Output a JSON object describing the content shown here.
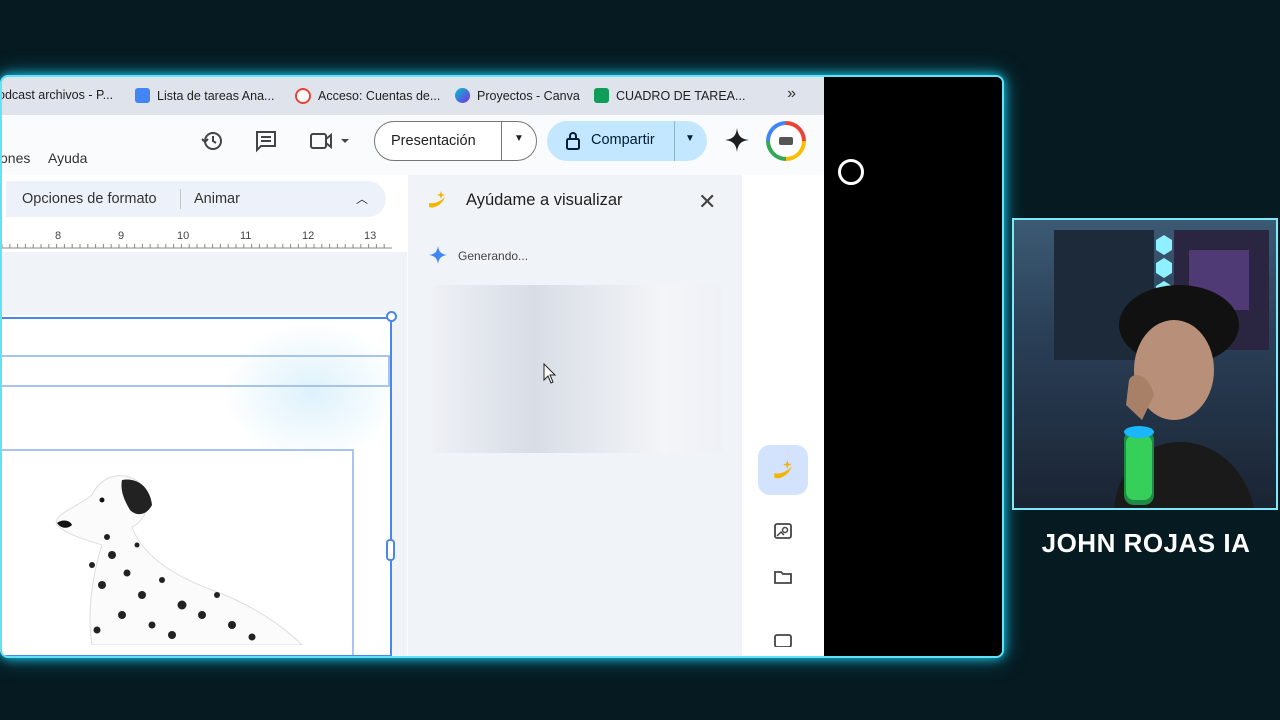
{
  "bookmarks": [
    {
      "label": "odcast archivos - P...",
      "icon": "page-icon",
      "color": "#777777"
    },
    {
      "label": "Lista de tareas Ana...",
      "icon": "docs-icon",
      "color": "#4285f4"
    },
    {
      "label": "Acceso: Cuentas de...",
      "icon": "google-icon",
      "color": "#ea4335"
    },
    {
      "label": "Proyectos - Canva",
      "icon": "canva-icon",
      "color": "#7d2ae8"
    },
    {
      "label": "CUADRO DE TAREA...",
      "icon": "sheets-icon",
      "color": "#0f9d58"
    }
  ],
  "bookmarks_more": "»",
  "menu": {
    "item1": "ones",
    "item2": "Ayuda"
  },
  "toolbar": {
    "history_icon": "history-icon",
    "comments_icon": "comment-icon",
    "meet_icon": "video-camera-icon",
    "presentation_label": "Presentación",
    "share_label": "Compartir",
    "gemini_icon": "gemini-star-icon"
  },
  "format_bar": {
    "options_label": "Opciones de formato",
    "animate_label": "Animar"
  },
  "ruler": {
    "ticks": [
      "8",
      "9",
      "10",
      "11",
      "12",
      "13"
    ]
  },
  "side_panel": {
    "title": "Ayúdame a visualizar",
    "status": "Generando..."
  },
  "streamer": {
    "name": "JOHN ROJAS IA"
  },
  "colors": {
    "frame_glow": "#19c6e8",
    "accent_blue": "#c2e7ff",
    "panel_bg": "#f0f4f9"
  }
}
